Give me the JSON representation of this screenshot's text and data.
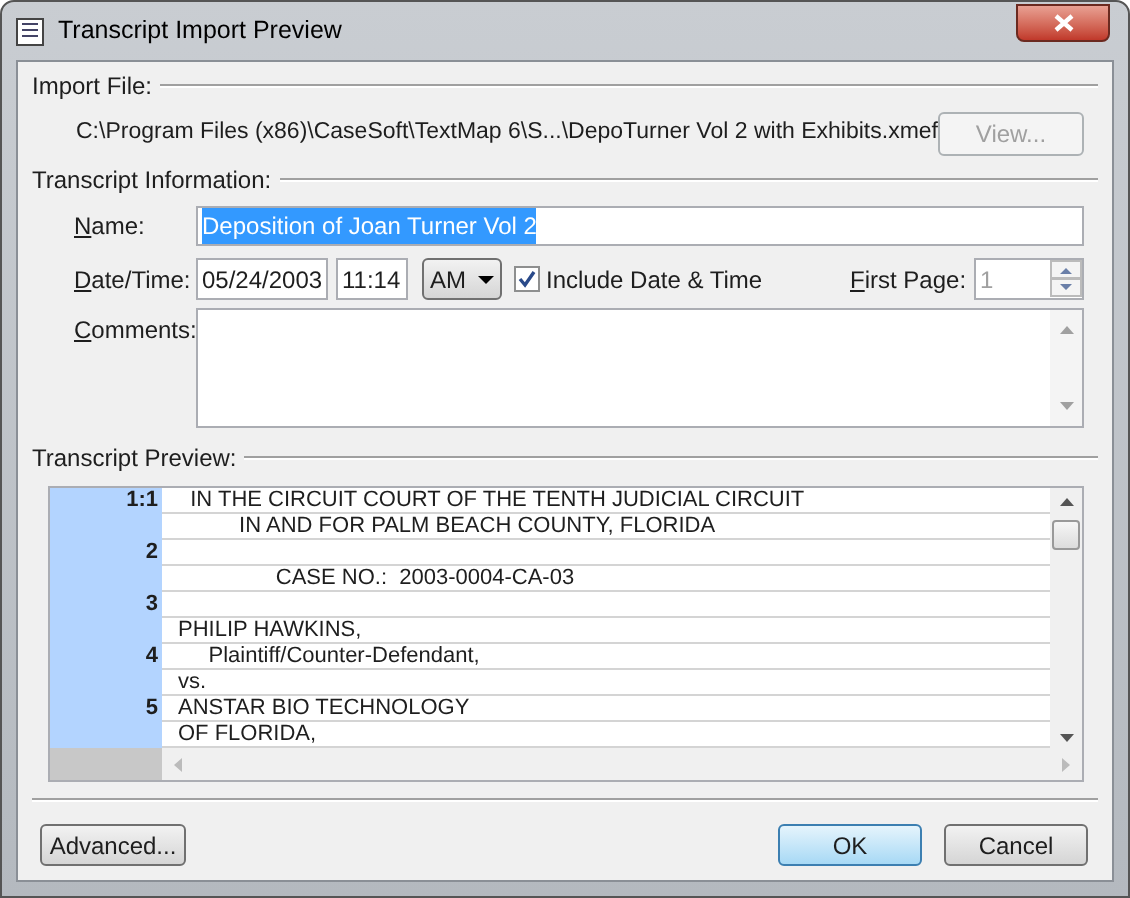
{
  "window": {
    "title": "Transcript Import Preview"
  },
  "import_file": {
    "heading": "Import File:",
    "path": "C:\\Program Files (x86)\\CaseSoft\\TextMap 6\\S...\\DepoTurner Vol 2 with Exhibits.xmef",
    "view_button": {
      "label": "View...",
      "disabled": true
    }
  },
  "transcript_information": {
    "heading": "Transcript Information:",
    "name": {
      "label": "Name:",
      "value": "Deposition of Joan Turner Vol 2",
      "selected_text": true
    },
    "date_time": {
      "label": "Date/Time:",
      "date": "05/24/2003",
      "time": "11:14",
      "ampm": "AM",
      "include": {
        "label": "Include Date & Time",
        "checked": true
      }
    },
    "first_page": {
      "label": "First Page:",
      "value": "1",
      "disabled": true
    },
    "comments": {
      "label": "Comments:"
    }
  },
  "transcript_preview": {
    "heading": "Transcript Preview:",
    "rows": [
      {
        "page": "1:1",
        "text": "  IN THE CIRCUIT COURT OF THE TENTH JUDICIAL CIRCUIT"
      },
      {
        "page": "",
        "text": "          IN AND FOR PALM BEACH COUNTY, FLORIDA"
      },
      {
        "page": "2",
        "text": ""
      },
      {
        "page": "",
        "text": "                CASE NO.:  2003-0004-CA-03"
      },
      {
        "page": "3",
        "text": ""
      },
      {
        "page": "",
        "text": "PHILIP HAWKINS,"
      },
      {
        "page": "4",
        "text": "     Plaintiff/Counter-Defendant,"
      },
      {
        "page": "",
        "text": "vs."
      },
      {
        "page": "5",
        "text": "ANSTAR BIO TECHNOLOGY"
      },
      {
        "page": "",
        "text": "OF FLORIDA,"
      }
    ]
  },
  "buttons": [
    {
      "label": "Advanced...",
      "default": false
    },
    {
      "label": "OK",
      "default": true
    },
    {
      "label": "Cancel",
      "default": false
    }
  ]
}
